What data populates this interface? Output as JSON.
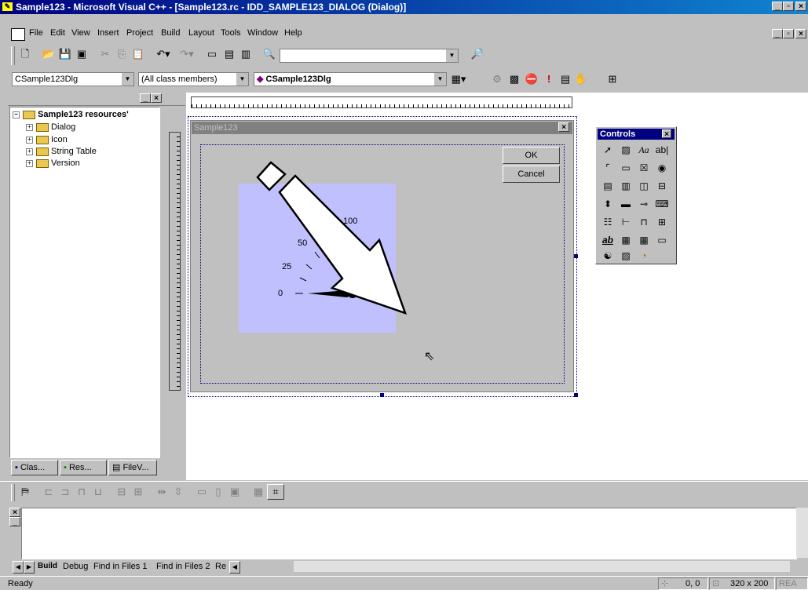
{
  "window": {
    "title": "Sample123 - Microsoft Visual C++ - [Sample123.rc - IDD_SAMPLE123_DIALOG (Dialog)]"
  },
  "menu": [
    "File",
    "Edit",
    "View",
    "Insert",
    "Project",
    "Build",
    "Layout",
    "Tools",
    "Window",
    "Help"
  ],
  "wizardbar": {
    "class": "CSample123Dlg",
    "filter": "(All class members)",
    "member": "CSample123Dlg"
  },
  "tree": {
    "root": "Sample123 resources",
    "items": [
      "Dialog",
      "Icon",
      "String Table",
      "Version"
    ]
  },
  "workspace_tabs": [
    "Clas...",
    "Res...",
    "FileV..."
  ],
  "dialog": {
    "title": "Sample123",
    "ok": "OK",
    "cancel": "Cancel",
    "gauge_labels": [
      "0",
      "25",
      "50",
      "100"
    ]
  },
  "controls_palette": {
    "title": "Controls"
  },
  "output_tabs": [
    "Build",
    "Debug",
    "Find in Files 1",
    "Find in Files 2",
    "Re"
  ],
  "status": {
    "text": "Ready",
    "pos": "0, 0",
    "size": "320 x 200",
    "mode": "REA"
  },
  "colors": {
    "titlebar": "#000080",
    "dialog_title": "#808080",
    "gauge_bg": "#c0c0ff"
  }
}
